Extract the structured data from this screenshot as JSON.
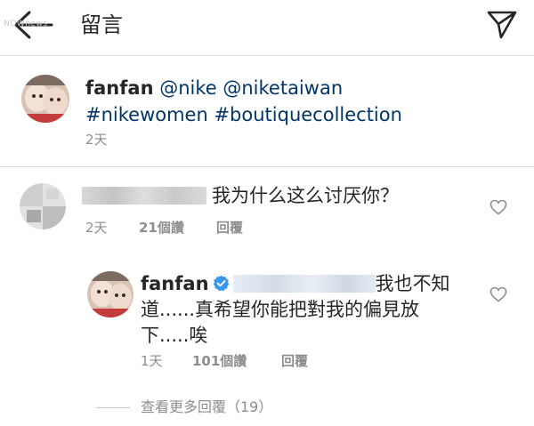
{
  "header": {
    "title": "留言",
    "watermark": "NOWnews",
    "back_icon": "arrow-left-icon",
    "send_icon": "paper-plane-icon"
  },
  "caption": {
    "username": "fanfan",
    "mentions": "@nike @niketaiwan",
    "hashtags": "#nikewomen #boutiquecollection",
    "time": "2天"
  },
  "comment": {
    "text": "我为什么这么讨厌你？",
    "time": "2天",
    "likes": "21個讚",
    "reply_label": "回覆",
    "heart_icon": "heart-outline-icon"
  },
  "reply": {
    "username": "fanfan",
    "mention_suffix": "_",
    "text": "我也不知道......真希望你能把對我的偏見放下.....唉",
    "time": "1天",
    "likes": "101個讚",
    "reply_label": "回覆",
    "heart_icon": "heart-outline-icon"
  },
  "view_more": "查看更多回覆（19）",
  "colors": {
    "text": "#262626",
    "meta": "#8e8e8e",
    "link": "#003569",
    "verified": "#3897f0",
    "divider": "#dbdbdb"
  }
}
